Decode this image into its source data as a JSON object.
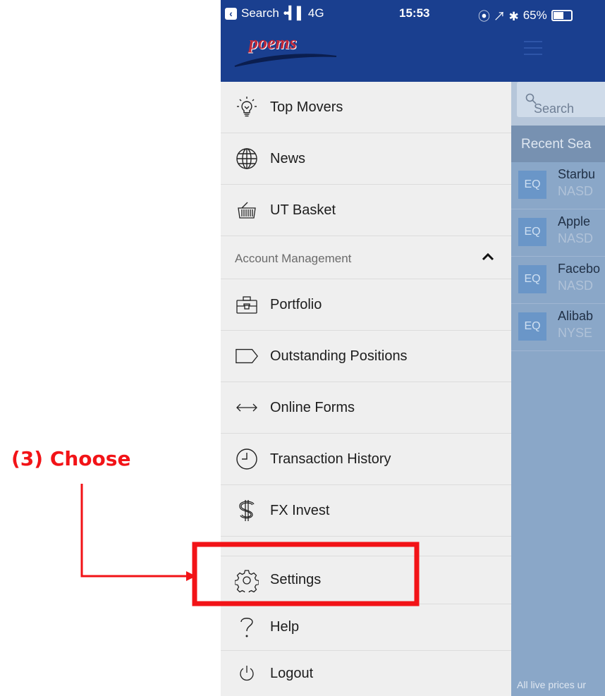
{
  "status_bar": {
    "back_label": "Search",
    "signal": "••▎▌",
    "network": "4G",
    "time": "15:53",
    "status_icons": "⦿ ↗ ✱",
    "battery_percent": "65%",
    "battery_level": 0.65
  },
  "header": {
    "logo_text": "poems",
    "menu_icon": "hamburger-icon"
  },
  "drawer": {
    "items": [
      {
        "label": "Top Movers",
        "icon": "lightbulb-icon"
      },
      {
        "label": "News",
        "icon": "globe-icon"
      },
      {
        "label": "UT Basket",
        "icon": "basket-icon"
      }
    ],
    "section": {
      "label": "Account Management",
      "toggle_icon": "chevron-up-icon"
    },
    "account_items": [
      {
        "label": "Portfolio",
        "icon": "briefcase-icon"
      },
      {
        "label": "Outstanding Positions",
        "icon": "tag-icon"
      },
      {
        "label": "Online Forms",
        "icon": "double-arrow-icon"
      },
      {
        "label": "Transaction History",
        "icon": "clock-icon"
      },
      {
        "label": "FX Invest",
        "icon": "dollar-icon"
      }
    ],
    "bottom_items": [
      {
        "label": "Settings",
        "icon": "gear-icon"
      },
      {
        "label": "Help",
        "icon": "question-icon"
      },
      {
        "label": "Logout",
        "icon": "power-icon"
      }
    ]
  },
  "background_screen": {
    "search_placeholder": "Search",
    "recent_header": "Recent Sea",
    "recent": [
      {
        "badge": "EQ",
        "name": "Starbu",
        "exchange": "NASD"
      },
      {
        "badge": "EQ",
        "name": "Apple",
        "exchange": "NASD"
      },
      {
        "badge": "EQ",
        "name": "Facebo",
        "exchange": "NASD"
      },
      {
        "badge": "EQ",
        "name": "Alibab",
        "exchange": "NYSE"
      }
    ],
    "footer_note": "All live prices ur"
  },
  "annotation": {
    "label": "(3) Choose",
    "color": "#f21317"
  }
}
